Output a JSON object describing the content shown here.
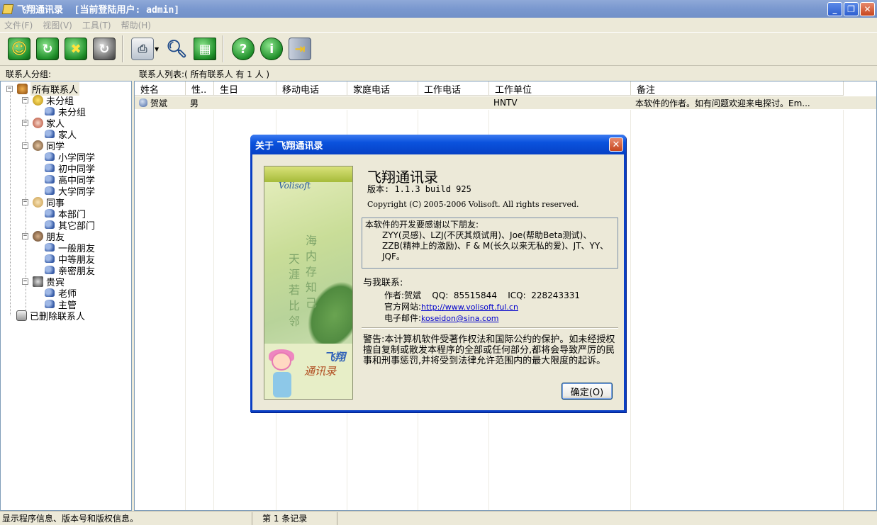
{
  "window": {
    "title": "飞翔通讯录  [当前登陆用户: admin]",
    "minimize": "_",
    "maximize": "❐",
    "close": "✕"
  },
  "menu": [
    {
      "label": "文件(F)"
    },
    {
      "label": "视图(V)"
    },
    {
      "label": "工具(T)"
    },
    {
      "label": "帮助(H)"
    }
  ],
  "toolbar": {
    "buttons": [
      "add-contact",
      "refresh",
      "delete",
      "settings",
      "print",
      "search",
      "calendar",
      "help",
      "about",
      "exit"
    ]
  },
  "labels": {
    "groups": "联系人分组:",
    "list": "联系人列表:( 所有联系人 有 1 人 )"
  },
  "tree": {
    "root": "所有联系人",
    "groups": [
      {
        "label": "未分组",
        "children": [
          "未分组"
        ]
      },
      {
        "label": "家人",
        "children": [
          "家人"
        ]
      },
      {
        "label": "同学",
        "children": [
          "小学同学",
          "初中同学",
          "高中同学",
          "大学同学"
        ]
      },
      {
        "label": "同事",
        "children": [
          "本部门",
          "其它部门"
        ]
      },
      {
        "label": "朋友",
        "children": [
          "一般朋友",
          "中等朋友",
          "亲密朋友"
        ]
      },
      {
        "label": "贵宾",
        "children": [
          "老师",
          "主管"
        ]
      }
    ],
    "deleted": "已删除联系人"
  },
  "grid": {
    "columns": [
      "姓名",
      "性..",
      "生日",
      "移动电话",
      "家庭电话",
      "工作电话",
      "工作单位",
      "备注"
    ],
    "rows": [
      {
        "name": "贺斌",
        "gender": "男",
        "birthday": "",
        "mobile": "",
        "home": "",
        "work": "",
        "company": "HNTV",
        "note": "本软件的作者。如有问题欢迎来电探讨。Em..."
      }
    ]
  },
  "status": {
    "info": "显示程序信息、版本号和版权信息。",
    "count": "第 1 条记录"
  },
  "about": {
    "title": "关于 飞翔通讯录",
    "app_name": "飞翔通讯录",
    "version": "版本: 1.1.3 build 925",
    "copyright": "Copyright (C) 2005-2006 Volisoft. All rights reserved.",
    "thanks_head": "本软件的开发要感谢以下朋友:",
    "thanks_body": "ZYY(灵感)、LZJ(不厌其烦试用)、Joe(帮助Beta测试)、ZZB(精神上的激励)、F & M(长久以来无私的爱)、JT、YY、JQF。",
    "contact_head": "与我联系:",
    "author": "作者:贺斌",
    "qq": "QQ:  85515844",
    "icq": "ICQ:  228243331",
    "website_label": "官方网站:",
    "website": "http://www.volisoft.ful.cn",
    "email_label": "电子邮件:",
    "email": "koseidon@sina.com",
    "warning": "警告:本计算机软件受著作权法和国际公约的保护。如未经授权擅自复制或散发本程序的全部或任何部分,都将会导致严厉的民事和刑事惩罚,并将受到法律允许范围内的最大限度的起诉。",
    "ok": "确定(O)",
    "splash_brand": "Volisoft",
    "splash_poem_1": "海内存知己",
    "splash_poem_2": "天涯若比邻",
    "splash_logo_1": "飞翔",
    "splash_logo_2": "通讯录"
  }
}
